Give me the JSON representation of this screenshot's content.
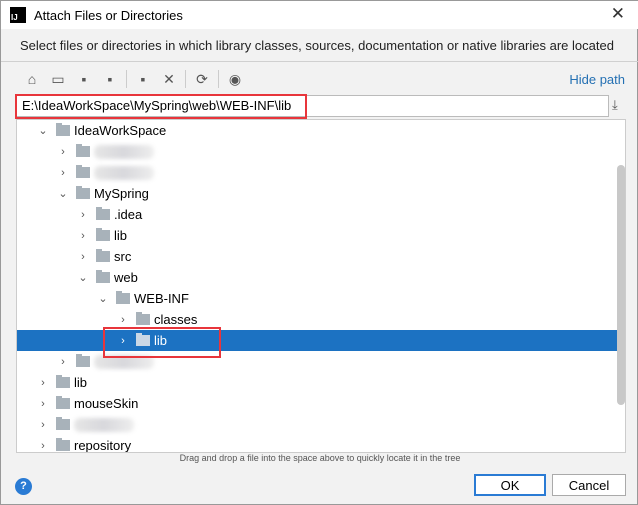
{
  "window": {
    "title": "Attach Files or Directories",
    "close": "✕"
  },
  "description": "Select files or directories in which library classes, sources, documentation or native libraries are located",
  "toolbar": {
    "hide_path": "Hide path"
  },
  "path": {
    "value": "E:\\IdeaWorkSpace\\MySpring\\web\\WEB-INF\\lib"
  },
  "tree": [
    {
      "label": "IdeaWorkSpace",
      "level": 0,
      "expanded": true
    },
    {
      "label": "",
      "level": 1,
      "blurred": true
    },
    {
      "label": "",
      "level": 1,
      "blurred": true
    },
    {
      "label": "MySpring",
      "level": 1,
      "expanded": true
    },
    {
      "label": ".idea",
      "level": 2
    },
    {
      "label": "lib",
      "level": 2
    },
    {
      "label": "src",
      "level": 2
    },
    {
      "label": "web",
      "level": 2,
      "expanded": true
    },
    {
      "label": "WEB-INF",
      "level": 3,
      "expanded": true
    },
    {
      "label": "classes",
      "level": 4
    },
    {
      "label": "lib",
      "level": 4,
      "selected": true
    },
    {
      "label": "",
      "level": 1,
      "blurred": true
    },
    {
      "label": "lib",
      "level": 0
    },
    {
      "label": "mouseSkin",
      "level": 0
    },
    {
      "label": "",
      "level": 0,
      "blurred": true
    },
    {
      "label": "repository",
      "level": 0
    }
  ],
  "hint": "Drag and drop a file into the space above to quickly locate it in the tree",
  "buttons": {
    "help": "?",
    "ok": "OK",
    "cancel": "Cancel"
  }
}
